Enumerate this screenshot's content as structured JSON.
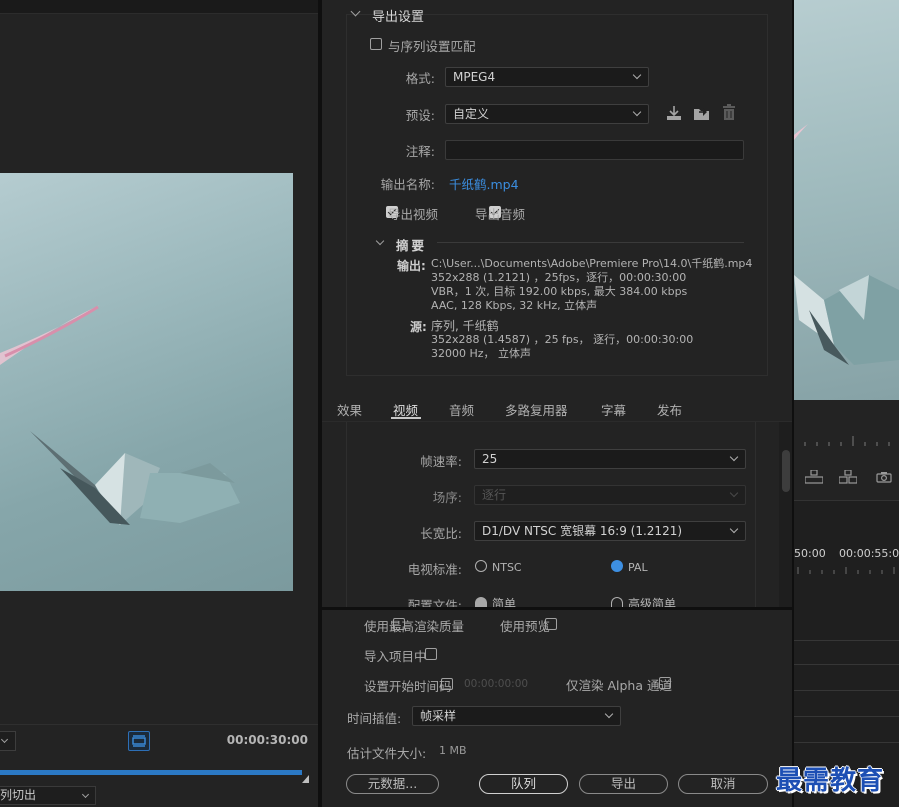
{
  "source_monitor": {
    "timecode": "00:00:30:00",
    "progress_fraction": 0.95,
    "transition_select": "列切出"
  },
  "program_monitor": {
    "time_a": "50:00",
    "time_b": "00:00:55:00"
  },
  "export_settings": {
    "section_title": "导出设置",
    "match_sequence_label": "与序列设置匹配",
    "match_sequence_checked": false,
    "format_label": "格式:",
    "format_value": "MPEG4",
    "preset_label": "预设:",
    "preset_value": "自定义",
    "comment_label": "注释:",
    "comment_value": "",
    "output_name_label": "输出名称:",
    "output_name_value": "千纸鹤.mp4",
    "export_video_label": "导出视频",
    "export_video_checked": true,
    "export_audio_label": "导出音频",
    "export_audio_checked": true,
    "summary": {
      "title": "摘要",
      "output_key": "输出:",
      "output_lines": [
        "C:\\User...\\Documents\\Adobe\\Premiere  Pro\\14.0\\千纸鹤.mp4",
        "352x288  (1.2121) ，25fps，逐行，00:00:30:00",
        "VBR，1 次, 目标 192.00 kbps, 最大 384.00 kbps",
        "AAC, 128 Kbps, 32  kHz, 立体声"
      ],
      "source_key": "源:",
      "source_lines": [
        "序列, 千纸鹤",
        "352x288  (1.4587) ，25 fps， 逐行，00:00:30:00",
        "32000 Hz， 立体声"
      ]
    }
  },
  "tabs": [
    {
      "label": "效果",
      "active": false
    },
    {
      "label": "视频",
      "active": true
    },
    {
      "label": "音频",
      "active": false
    },
    {
      "label": "多路复用器",
      "active": false
    },
    {
      "label": "字幕",
      "active": false
    },
    {
      "label": "发布",
      "active": false
    }
  ],
  "video_settings": {
    "frame_rate_label": "帧速率:",
    "frame_rate_value": "25",
    "field_order_label": "场序:",
    "field_order_value": "逐行",
    "aspect_label": "长宽比:",
    "aspect_value": "D1/DV NTSC 宽银幕 16:9 (1.2121)",
    "tv_standard_label": "电视标准:",
    "tv_ntsc": "NTSC",
    "tv_pal": "PAL",
    "tv_selected": "PAL",
    "profile_label": "配置文件:",
    "profile_simple": "简单",
    "profile_advanced_simple": "高级简单"
  },
  "bottom_options": {
    "max_render_quality": "使用最高渲染质量",
    "use_previews": "使用预览",
    "import_into_project": "导入项目中",
    "set_start_timecode": "设置开始时间码",
    "start_timecode_value": "00:00:00:00",
    "render_alpha_only": "仅渲染 Alpha 通道",
    "time_interpolation_label": "时间插值:",
    "time_interpolation_value": "帧采样",
    "estimated_size_label": "估计文件大小:",
    "estimated_size_value": "1 MB"
  },
  "buttons": {
    "metadata": "元数据...",
    "queue": "队列",
    "export": "导出",
    "cancel": "取消"
  },
  "watermark": "最需教育",
  "colors": {
    "accent_blue": "#3b8ee0",
    "panel_bg": "#232323",
    "watermark": "#1d4fb4"
  }
}
